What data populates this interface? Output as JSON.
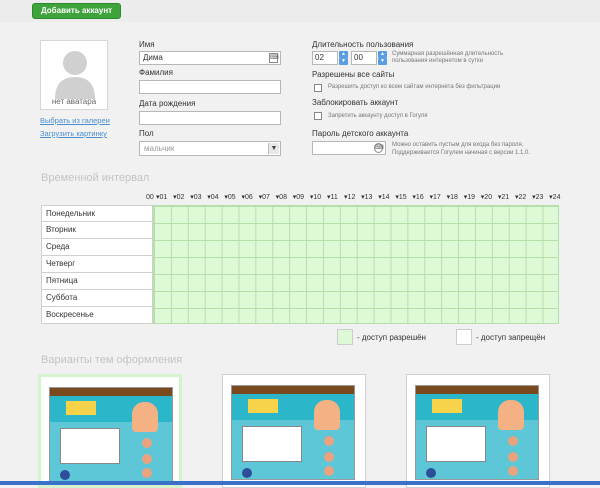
{
  "toolbar": {
    "add_account_label": "Добавить аккаунт"
  },
  "profile": {
    "no_avatar": "нет аватара",
    "choose_gallery": "Выбрать из галереи",
    "upload_picture": "Загрузить картинку",
    "name_label": "Имя",
    "name_value": "Дима",
    "surname_label": "Фамилия",
    "surname_value": "",
    "birthdate_label": "Дата рождения",
    "birthdate_value": "",
    "gender_label": "Пол",
    "gender_value": "мальчик"
  },
  "settings": {
    "duration_label": "Длительность пользования",
    "hours_value": "02",
    "minutes_value": "00",
    "duration_hint_1": "Суммарная разрешённая длительность",
    "duration_hint_2": "пользования интернетом в сутки",
    "all_sites_label": "Разрешены все сайты",
    "all_sites_option": "Разрешить доступ ко всем сайтам интернета без фильтрации",
    "block_label": "Заблокировать аккаунт",
    "block_option": "Запретить аккаунту доступ в Гогуля",
    "password_label": "Пароль детского аккаунта",
    "password_hint_1": "Можно оставить пустым для входа без пароля.",
    "password_hint_2": "Поддерживается Гогулем начиная с версии 1.1.0."
  },
  "schedule": {
    "title": "Временной интервал",
    "hours": [
      "00",
      "01",
      "02",
      "03",
      "04",
      "05",
      "06",
      "07",
      "08",
      "09",
      "10",
      "11",
      "12",
      "13",
      "14",
      "15",
      "16",
      "17",
      "18",
      "19",
      "20",
      "21",
      "22",
      "23",
      "24"
    ],
    "days": [
      "Понедельник",
      "Вторник",
      "Среда",
      "Четверг",
      "Пятница",
      "Суббота",
      "Воскресенье"
    ],
    "allowed_label": "- доступ разрешён",
    "denied_label": "- доступ запрещён",
    "allowed_color": "#ddf9d6",
    "denied_color": "#ffffff"
  },
  "themes": {
    "title": "Варианты тем оформления",
    "items": [
      {
        "name": "theme-1",
        "selected": true
      },
      {
        "name": "theme-2",
        "selected": false
      },
      {
        "name": "theme-3",
        "selected": false
      }
    ]
  }
}
